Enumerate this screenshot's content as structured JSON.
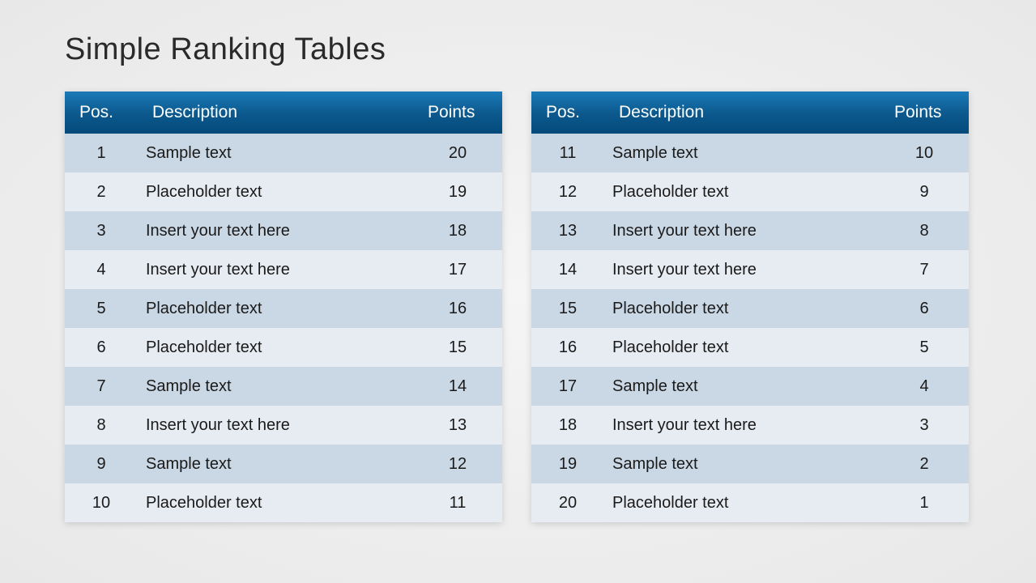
{
  "title": "Simple Ranking Tables",
  "headers": {
    "pos": "Pos.",
    "desc": "Description",
    "points": "Points"
  },
  "tables": [
    {
      "rows": [
        {
          "pos": "1",
          "desc": "Sample text",
          "points": "20"
        },
        {
          "pos": "2",
          "desc": "Placeholder text",
          "points": "19"
        },
        {
          "pos": "3",
          "desc": "Insert your text here",
          "points": "18"
        },
        {
          "pos": "4",
          "desc": "Insert your text here",
          "points": "17"
        },
        {
          "pos": "5",
          "desc": "Placeholder text",
          "points": "16"
        },
        {
          "pos": "6",
          "desc": "Placeholder text",
          "points": "15"
        },
        {
          "pos": "7",
          "desc": "Sample text",
          "points": "14"
        },
        {
          "pos": "8",
          "desc": "Insert your text here",
          "points": "13"
        },
        {
          "pos": "9",
          "desc": "Sample text",
          "points": "12"
        },
        {
          "pos": "10",
          "desc": "Placeholder text",
          "points": "11"
        }
      ]
    },
    {
      "rows": [
        {
          "pos": "11",
          "desc": "Sample text",
          "points": "10"
        },
        {
          "pos": "12",
          "desc": "Placeholder text",
          "points": "9"
        },
        {
          "pos": "13",
          "desc": "Insert your text here",
          "points": "8"
        },
        {
          "pos": "14",
          "desc": "Insert your text here",
          "points": "7"
        },
        {
          "pos": "15",
          "desc": "Placeholder text",
          "points": "6"
        },
        {
          "pos": "16",
          "desc": "Placeholder text",
          "points": "5"
        },
        {
          "pos": "17",
          "desc": "Sample text",
          "points": "4"
        },
        {
          "pos": "18",
          "desc": "Insert your text here",
          "points": "3"
        },
        {
          "pos": "19",
          "desc": "Sample text",
          "points": "2"
        },
        {
          "pos": "20",
          "desc": "Placeholder text",
          "points": "1"
        }
      ]
    }
  ]
}
